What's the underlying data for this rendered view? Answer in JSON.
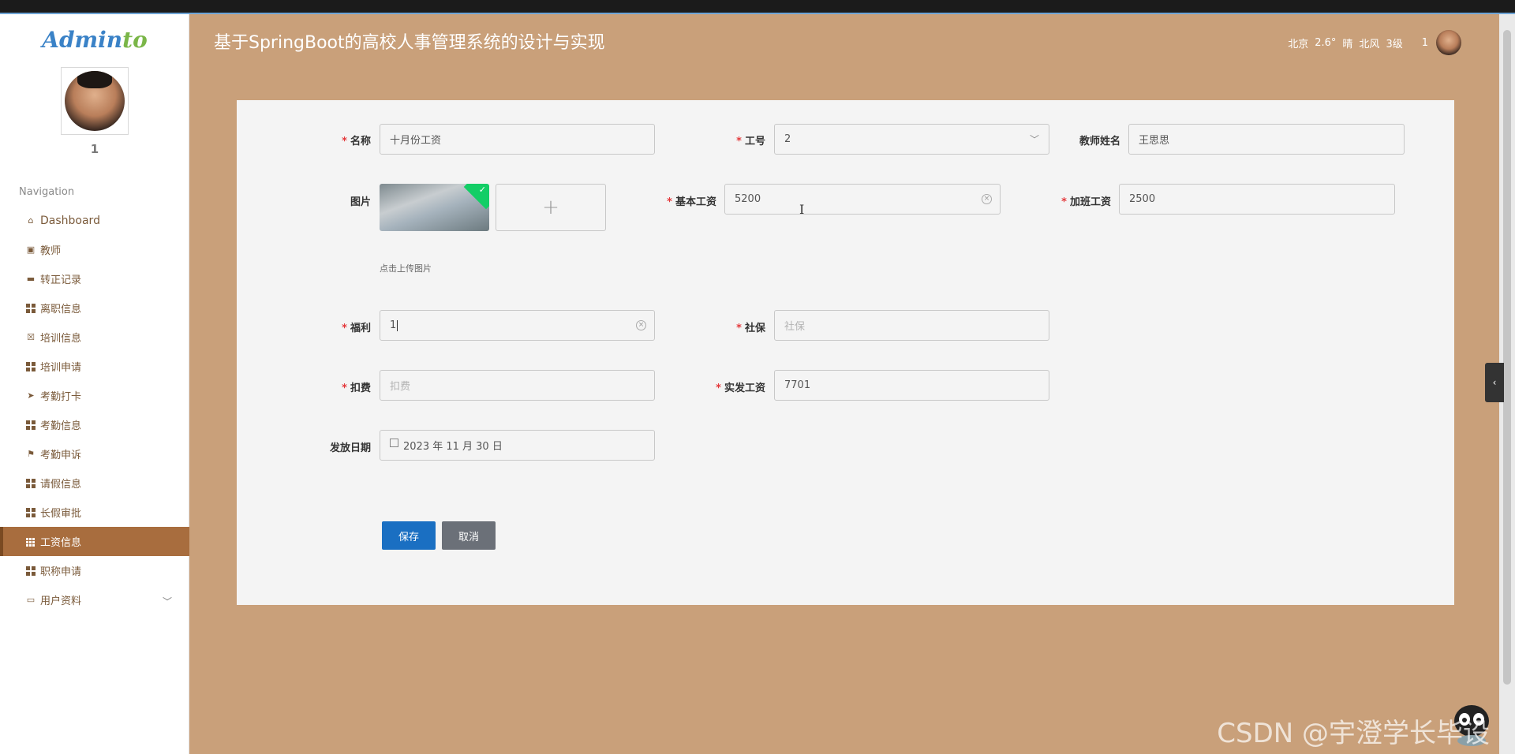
{
  "app": {
    "logo_part1": "Admin",
    "logo_part2": "to",
    "title": "基于SpringBoot的高校人事管理系统的设计与实现"
  },
  "header": {
    "city": "北京",
    "temp": "2.6°",
    "weather": "晴",
    "wind": "北风",
    "wind_level": "3级",
    "user": "1"
  },
  "sidebar": {
    "user_name": "1",
    "nav_title": "Navigation",
    "items": [
      {
        "label": "Dashboard",
        "icon": "home-icon"
      },
      {
        "label": "教师",
        "icon": "clipboard-icon"
      },
      {
        "label": "转正记录",
        "icon": "card-icon"
      },
      {
        "label": "离职信息",
        "icon": "grid-icon"
      },
      {
        "label": "培训信息",
        "icon": "calendar-x-icon"
      },
      {
        "label": "培训申请",
        "icon": "grid-icon"
      },
      {
        "label": "考勤打卡",
        "icon": "paper-plane-icon"
      },
      {
        "label": "考勤信息",
        "icon": "grid-icon"
      },
      {
        "label": "考勤申诉",
        "icon": "flag-icon"
      },
      {
        "label": "请假信息",
        "icon": "grid-icon"
      },
      {
        "label": "长假审批",
        "icon": "grid-icon"
      },
      {
        "label": "工资信息",
        "icon": "grid9-icon",
        "active": true
      },
      {
        "label": "职称申请",
        "icon": "grid-icon"
      },
      {
        "label": "用户资料",
        "icon": "id-card-icon"
      }
    ]
  },
  "form": {
    "name": {
      "label": "名称",
      "value": "十月份工资"
    },
    "job_no": {
      "label": "工号",
      "value": "2"
    },
    "teacher_name": {
      "label": "教师姓名",
      "value": "王思思"
    },
    "image": {
      "label": "图片",
      "hint": "点击上传图片",
      "add_symbol": "+"
    },
    "base_salary": {
      "label": "基本工资",
      "value": "5200"
    },
    "overtime_pay": {
      "label": "加班工资",
      "value": "2500"
    },
    "welfare": {
      "label": "福利",
      "value": "1"
    },
    "social_security": {
      "label": "社保",
      "placeholder": "社保"
    },
    "deduction": {
      "label": "扣费",
      "placeholder": "扣费"
    },
    "net_salary": {
      "label": "实发工资",
      "value": "7701"
    },
    "pay_date": {
      "label": "发放日期",
      "value": "2023 年 11 月 30 日"
    }
  },
  "buttons": {
    "save": "保存",
    "cancel": "取消"
  },
  "watermark": "CSDN @宇澄学长毕设",
  "colors": {
    "background": "#c9a07a",
    "active_nav": "#a86d3e",
    "primary_button": "#1a6fc2",
    "required_mark": "#e4393c"
  }
}
